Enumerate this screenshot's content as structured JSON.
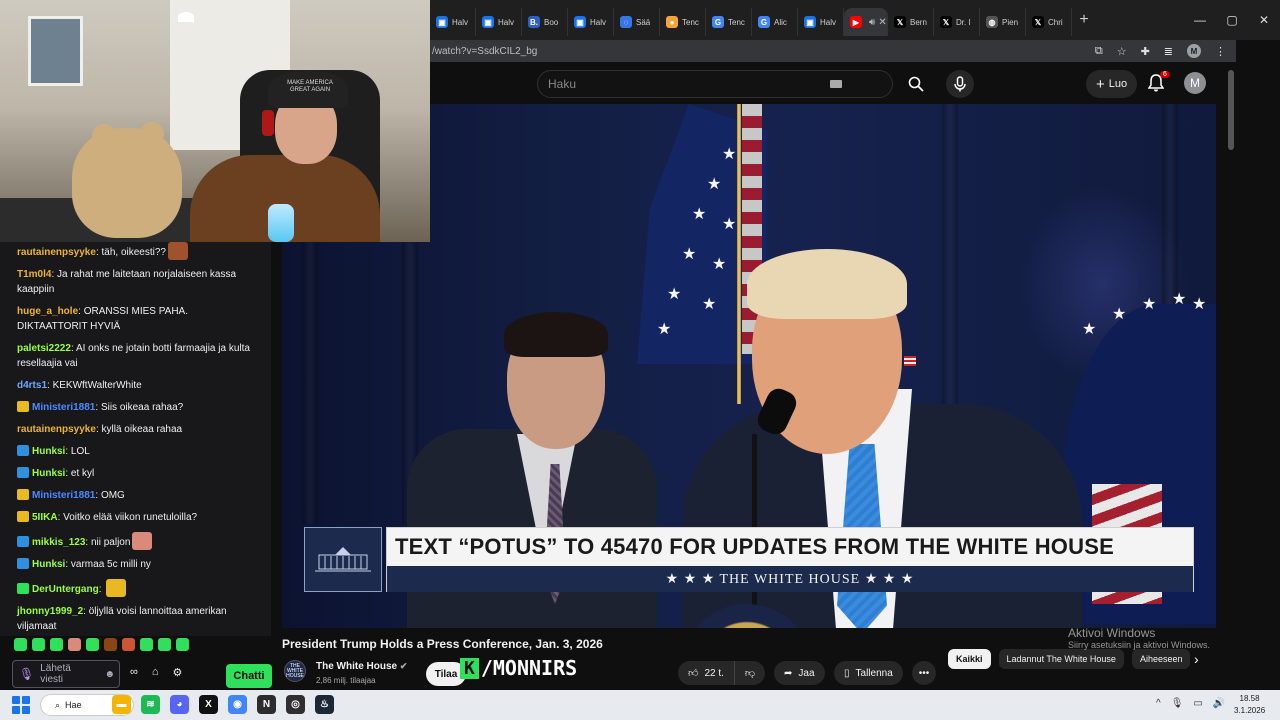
{
  "browser": {
    "tabs": [
      {
        "label": "Halv",
        "favicon_color": "#1a73e8",
        "favicon": "▣"
      },
      {
        "label": "Halv",
        "favicon_color": "#1a73e8",
        "favicon": "▣"
      },
      {
        "label": "Boo",
        "favicon_color": "#2d5ec9",
        "favicon": "B."
      },
      {
        "label": "Halv",
        "favicon_color": "#1a73e8",
        "favicon": "▣"
      },
      {
        "label": "Sää",
        "favicon_color": "#3578e5",
        "favicon": "◌"
      },
      {
        "label": "Tenc",
        "favicon_color": "#f2a43b",
        "favicon": "●"
      },
      {
        "label": "Tenc",
        "favicon_color": "#4285f4",
        "favicon": "G"
      },
      {
        "label": "Alic",
        "favicon_color": "#4285f4",
        "favicon": "G"
      },
      {
        "label": "Halv",
        "favicon_color": "#1a73e8",
        "favicon": "▣"
      },
      {
        "label": "(",
        "favicon_color": "#ff0000",
        "favicon": "▶",
        "active": true
      },
      {
        "label": "Bern",
        "favicon_color": "#000000",
        "favicon": "𝕏"
      },
      {
        "label": "Dr. I",
        "favicon_color": "#000000",
        "favicon": "𝕏"
      },
      {
        "label": "Pien",
        "favicon_color": "#555555",
        "favicon": "◍"
      },
      {
        "label": "Chri",
        "favicon_color": "#000000",
        "favicon": "𝕏"
      }
    ],
    "new_tab": "+",
    "url": "/watch?v=SsdkCIL2_bg",
    "profile_initial": "M",
    "window_controls": {
      "minimize": "—",
      "maximize": "▢",
      "close": "✕"
    }
  },
  "youtube": {
    "search_placeholder": "Haku",
    "create_label": "Luo",
    "notifications_count": "6",
    "avatar_initial": "M",
    "video_title": "President Trump Holds a Press Conference, Jan. 3, 2026",
    "channel_name": "The White House",
    "channel_avatar_text": "THE WHITE HOUSE",
    "subscribers": "2,86 milj. tilaajaa",
    "subscribe_label": "Tilaa",
    "likes": "22 t.",
    "share_label": "Jaa",
    "save_label": "Tallenna",
    "more_label": "•••",
    "chips": [
      "Kaikki",
      "Ladannut The White House",
      "Aiheeseen"
    ],
    "chip_next": "›"
  },
  "overlay": {
    "lower_third_headline": "TEXT “POTUS” TO 45470 FOR UPDATES FROM THE WHITE HOUSE",
    "lower_third_sub": "★ ★ ★  THE WHITE HOUSE  ★ ★ ★",
    "watermark_k": "K",
    "watermark_text": "/MONNIRS",
    "cap_text": "MAKE AMERICA GREAT AGAIN"
  },
  "windows_activation": {
    "line1": "Aktivoi Windows",
    "line2": "Siirry asetuksiin ja aktivoi Windows."
  },
  "chat": {
    "messages": [
      {
        "user": "rautainenpsyyke",
        "color": "#f0b429",
        "text": "täh, oikeesti??",
        "badge": null,
        "emote": "#a0522d"
      },
      {
        "user": "T1m0l4",
        "color": "#f0b429",
        "text": "Ja rahat me laitetaan norjalaiseen kassa kaappiin",
        "badge": null
      },
      {
        "user": "huge_a_hole",
        "color": "#f0b429",
        "text": "ORANSSI MIES PAHA. DIKTAATTORIT HYVIÄ",
        "badge": null
      },
      {
        "user": "paletsi2222",
        "color": "#9bff3a",
        "text": "AI onks ne jotain botti farmaajia ja kulta resellaajia vai",
        "badge": null
      },
      {
        "user": "d4rts1",
        "color": "#6fa8ff",
        "text": "KEKWftWalterWhite",
        "badge": null
      },
      {
        "user": "Ministeri1881",
        "color": "#4b8bff",
        "text": "Siis oikeaa rahaa?",
        "badge": "#e8b923"
      },
      {
        "user": "rautainenpsyyke",
        "color": "#f0b429",
        "text": "kyllä oikeaa rahaa",
        "badge": null
      },
      {
        "user": "Hunksi",
        "color": "#9bff3a",
        "text": "LOL",
        "badge": "#2f8fe0"
      },
      {
        "user": "Hunksi",
        "color": "#9bff3a",
        "text": "et kyl",
        "badge": "#2f8fe0"
      },
      {
        "user": "Ministeri1881",
        "color": "#4b8bff",
        "text": "OMG",
        "badge": "#e8b923"
      },
      {
        "user": "5IIKA",
        "color": "#9bff3a",
        "text": "Voitko elää viikon runetuloilla?",
        "badge": "#e8b923"
      },
      {
        "user": "mikkis_123",
        "color": "#9bff3a",
        "text": "nii paljon",
        "badge": "#2f8fe0",
        "emote": "#d98a7a"
      },
      {
        "user": "Hunksi",
        "color": "#9bff3a",
        "text": "varmaa 5c milli ny",
        "badge": "#2f8fe0"
      },
      {
        "user": "DerUntergang",
        "color": "#9bff3a",
        "text": "",
        "badge": "#2fe05b",
        "emote": "#e8b923"
      },
      {
        "user": "jhonny1999_2",
        "color": "#9bff3a",
        "text": "öljyllä voisi lannoittaa amerikan viljamaat",
        "badge": null
      }
    ],
    "emote_bar_colors": [
      "#2fe05b",
      "#2fe05b",
      "#2fe05b",
      "#d98a7a",
      "#2fe05b",
      "#8b4513",
      "#cc5533",
      "#2fe05b",
      "#2fe05b",
      "#2fe05b"
    ],
    "input_placeholder": "Lähetä viesti",
    "send_label": "Chatti",
    "bits_label": "∞"
  },
  "taskbar": {
    "search_label": "Hae",
    "time": "18.58",
    "date": "3.1.2026",
    "apps": [
      {
        "name": "file-explorer",
        "color": "#f4b400",
        "glyph": "▬"
      },
      {
        "name": "spotify",
        "color": "#1db954",
        "glyph": "≋"
      },
      {
        "name": "discord",
        "color": "#5865f2",
        "glyph": "◕"
      },
      {
        "name": "x",
        "color": "#111111",
        "glyph": "X"
      },
      {
        "name": "chrome",
        "color": "#4285f4",
        "glyph": "◉"
      },
      {
        "name": "app-n",
        "color": "#2c2c2c",
        "glyph": "N"
      },
      {
        "name": "obs",
        "color": "#302e31",
        "glyph": "◎"
      },
      {
        "name": "steam",
        "color": "#1b2838",
        "glyph": "♨"
      }
    ],
    "tray_icons": [
      "^",
      "🎙",
      "▭",
      "🔊"
    ]
  }
}
